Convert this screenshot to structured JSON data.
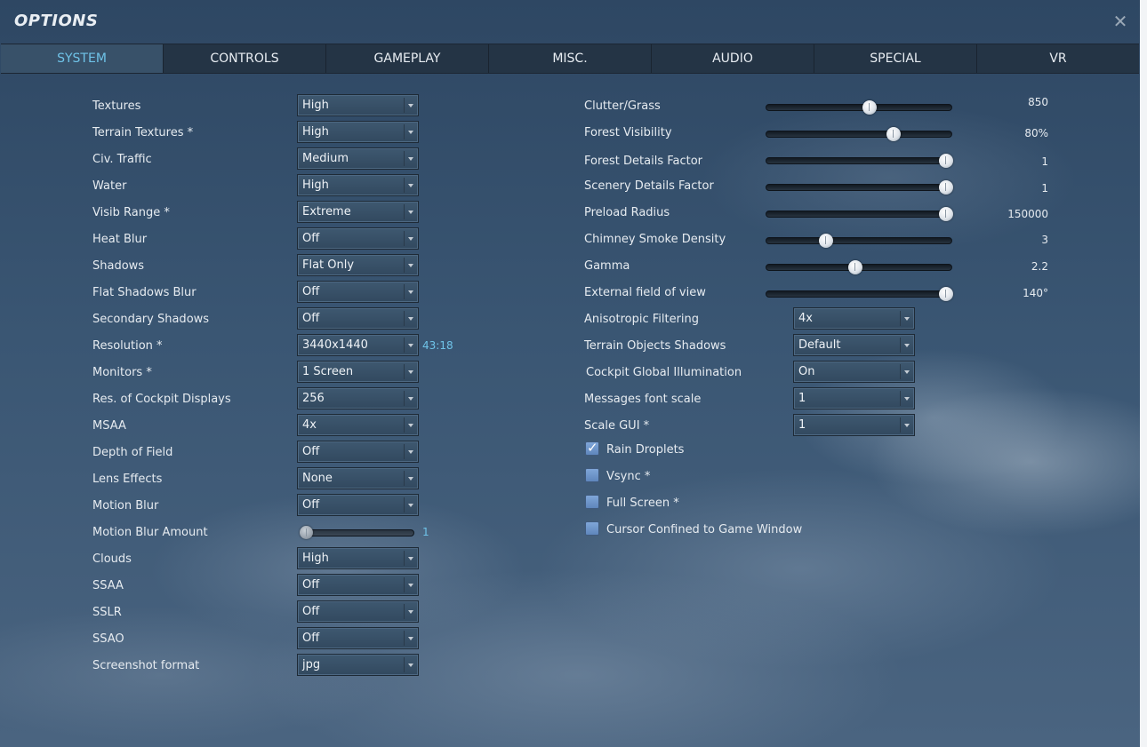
{
  "window": {
    "title": "OPTIONS"
  },
  "tabs": [
    {
      "label": "SYSTEM",
      "active": true
    },
    {
      "label": "CONTROLS"
    },
    {
      "label": "GAMEPLAY"
    },
    {
      "label": "MISC."
    },
    {
      "label": "AUDIO"
    },
    {
      "label": "SPECIAL"
    },
    {
      "label": "VR"
    }
  ],
  "left": {
    "textures": {
      "label": "Textures",
      "value": "High"
    },
    "terrain_textures": {
      "label": "Terrain Textures *",
      "value": "High"
    },
    "civ_traffic": {
      "label": "Civ. Traffic",
      "value": "Medium"
    },
    "water": {
      "label": "Water",
      "value": "High"
    },
    "visib_range": {
      "label": "Visib Range *",
      "value": "Extreme"
    },
    "heat_blur": {
      "label": "Heat Blur",
      "value": "Off"
    },
    "shadows": {
      "label": "Shadows",
      "value": "Flat Only"
    },
    "flat_shadows_blur": {
      "label": "Flat Shadows Blur",
      "value": "Off"
    },
    "secondary_shadows": {
      "label": "Secondary Shadows",
      "value": "Off"
    },
    "resolution": {
      "label": "Resolution *",
      "value": "3440x1440",
      "aspect": "43:18"
    },
    "monitors": {
      "label": "Monitors *",
      "value": "1 Screen"
    },
    "res_cockpit_displays": {
      "label": "Res. of Cockpit Displays",
      "value": "256"
    },
    "msaa": {
      "label": "MSAA",
      "value": "4x"
    },
    "depth_of_field": {
      "label": "Depth of Field",
      "value": "Off"
    },
    "lens_effects": {
      "label": "Lens Effects",
      "value": "None"
    },
    "motion_blur": {
      "label": "Motion Blur",
      "value": "Off"
    },
    "motion_blur_amount": {
      "label": "Motion Blur Amount",
      "value": "1",
      "fraction": 0.0
    },
    "clouds": {
      "label": "Clouds",
      "value": "High"
    },
    "ssaa": {
      "label": "SSAA",
      "value": "Off"
    },
    "sslr": {
      "label": "SSLR",
      "value": "Off"
    },
    "ssao": {
      "label": "SSAO",
      "value": "Off"
    },
    "screenshot_format": {
      "label": "Screenshot format",
      "value": "jpg"
    }
  },
  "right": {
    "clutter_grass": {
      "label": "Clutter/Grass",
      "value": "850",
      "fraction": 0.56
    },
    "forest_visibility": {
      "label": "Forest Visibility",
      "value": "80%",
      "fraction": 0.7
    },
    "forest_details": {
      "label": "Forest Details Factor",
      "value": "1",
      "fraction": 1.0
    },
    "scenery_details": {
      "label": "Scenery Details Factor",
      "value": "1",
      "fraction": 1.0
    },
    "preload_radius": {
      "label": "Preload Radius",
      "value": "150000",
      "fraction": 1.0
    },
    "chimney_smoke": {
      "label": "Chimney Smoke Density",
      "value": "3",
      "fraction": 0.31
    },
    "gamma": {
      "label": "Gamma",
      "value": "2.2",
      "fraction": 0.48
    },
    "external_fov": {
      "label": "External field of view",
      "value": "140°",
      "fraction": 1.0
    },
    "anisotropic": {
      "label": "Anisotropic Filtering",
      "value": "4x"
    },
    "terrain_objects_shadows": {
      "label": "Terrain Objects Shadows",
      "value": "Default"
    },
    "cockpit_gi": {
      "label": "Cockpit Global Illumination",
      "value": "On"
    },
    "messages_font_scale": {
      "label": "Messages font scale",
      "value": "1"
    },
    "scale_gui": {
      "label": "Scale GUI *",
      "value": "1"
    },
    "rain_droplets": {
      "label": "Rain Droplets",
      "checked": true
    },
    "vsync": {
      "label": "Vsync *",
      "checked": false
    },
    "full_screen": {
      "label": "Full Screen *",
      "checked": false
    },
    "cursor_confined": {
      "label": "Cursor Confined to Game Window",
      "checked": false
    }
  },
  "icons": {
    "close": "close-icon",
    "dropdown": "chevron-down-icon",
    "checkbox_tick": "check-icon"
  }
}
